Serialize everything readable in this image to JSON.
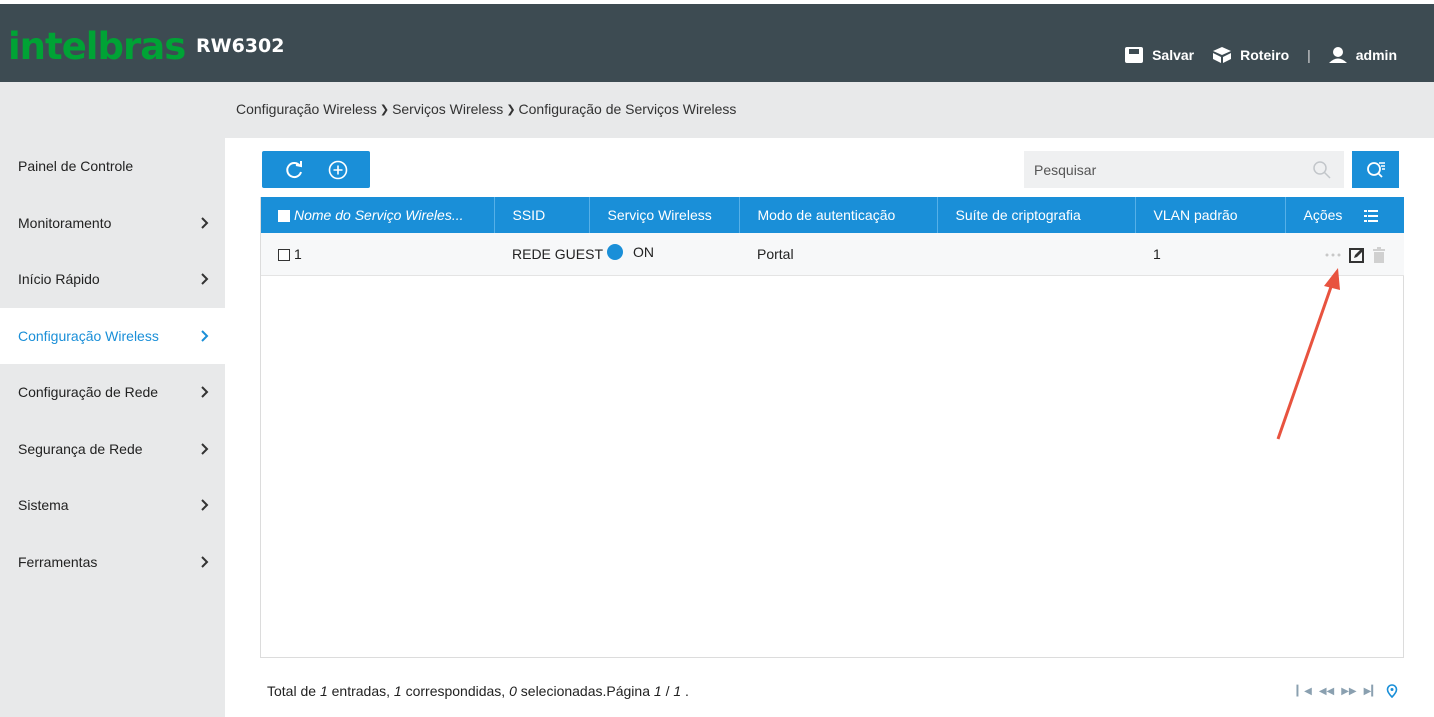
{
  "header": {
    "logo": "intelbras",
    "model": "RW6302",
    "save_label": "Salvar",
    "roadmap_label": "Roteiro",
    "separator": "|",
    "user_label": "admin"
  },
  "breadcrumb": {
    "items": [
      "Configuração Wireless",
      "Serviços Wireless",
      "Configuração de Serviços Wireless"
    ]
  },
  "sidebar": {
    "items": [
      {
        "label": "Painel de Controle"
      },
      {
        "label": "Monitoramento"
      },
      {
        "label": "Início Rápido"
      },
      {
        "label": "Configuração Wireless"
      },
      {
        "label": "Configuração de Rede"
      },
      {
        "label": "Segurança de Rede"
      },
      {
        "label": "Sistema"
      },
      {
        "label": "Ferramentas"
      }
    ]
  },
  "search": {
    "placeholder": "Pesquisar"
  },
  "table": {
    "columns": [
      "Nome do Serviço Wireles...",
      "SSID",
      "Serviço Wireless",
      "Modo de autenticação",
      "Suíte de criptografia",
      "VLAN padrão",
      "Ações"
    ],
    "rows": [
      {
        "name": "1",
        "ssid": "REDE GUEST",
        "service": "ON",
        "auth": "Portal",
        "crypto": "",
        "vlan": "1"
      }
    ]
  },
  "footer": {
    "p1": "Total de ",
    "total": "1",
    "p2": " entradas, ",
    "matched": "1",
    "p3": " correspondidas, ",
    "selected": "0",
    "p4": " selecionadas.Página ",
    "page": "1",
    "p5": " / ",
    "pages": "1",
    "p6": " ."
  },
  "colors": {
    "accent": "#1a8fd8",
    "brand": "#00a335",
    "header_bg": "#3d4b52",
    "annotation": "#e8533f"
  }
}
